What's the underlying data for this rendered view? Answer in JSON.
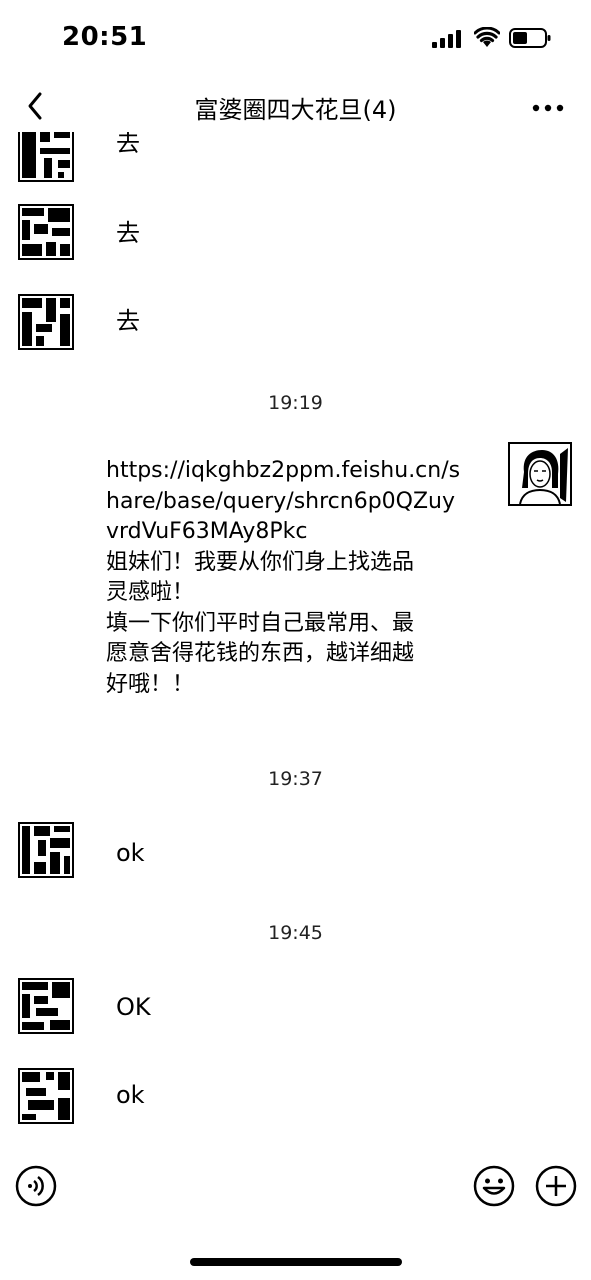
{
  "status_bar": {
    "time": "20:51"
  },
  "header": {
    "title": "富婆圈四大花旦(4)",
    "back_icon": "chevron-left-icon",
    "more_icon": "ellipsis-icon"
  },
  "messages": [
    {
      "sender": "other",
      "text": "去"
    },
    {
      "sender": "other",
      "text": "去"
    },
    {
      "sender": "other",
      "text": "去"
    },
    {
      "type": "timestamp",
      "text": "19:19"
    },
    {
      "sender": "self",
      "lines": [
        "https://iqkghbz2ppm.feishu.cn/s",
        "hare/base/query/shrcn6p0QZuy",
        "vrdVuF63MAy8Pkc",
        "姐妹们！我要从你们身上找选品",
        "灵感啦！",
        "填一下你们平时自己最常用、最",
        "愿意舍得花钱的东西，越详细越",
        "好哦！！"
      ]
    },
    {
      "type": "timestamp",
      "text": "19:37"
    },
    {
      "sender": "other",
      "text": "ok"
    },
    {
      "type": "timestamp",
      "text": "19:45"
    },
    {
      "sender": "other",
      "text": "OK"
    },
    {
      "sender": "other",
      "text": "ok"
    }
  ],
  "input_bar": {
    "voice_icon": "voice-icon",
    "emoji_icon": "emoji-icon",
    "plus_icon": "plus-icon"
  }
}
